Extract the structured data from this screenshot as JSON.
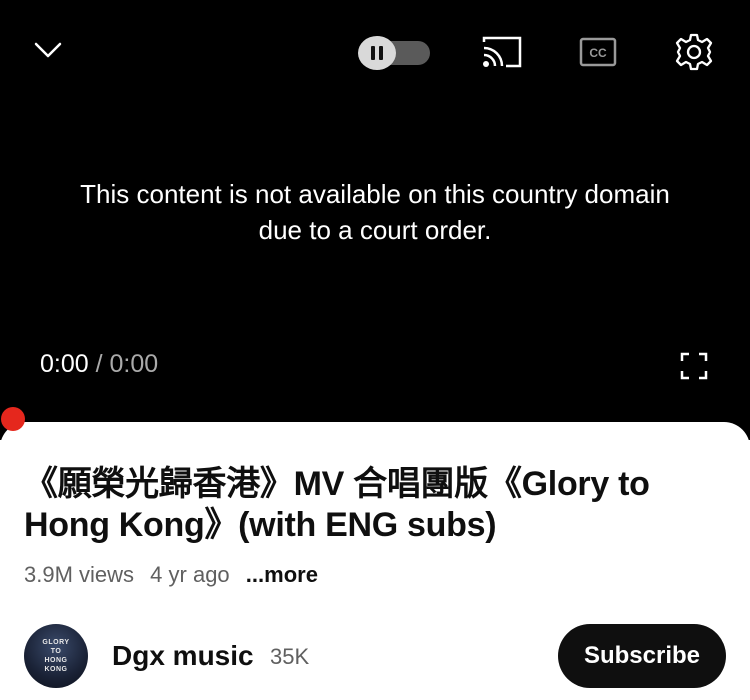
{
  "player": {
    "notice": {
      "line1": "This content is not available on this country domain",
      "line2": "due to a court order."
    },
    "time": {
      "current": "0:00",
      "separator": " / ",
      "duration": "0:00"
    },
    "icons": {
      "collapse": "chevron-down-icon",
      "autoplay": "pause-toggle-icon",
      "cast": "cast-icon",
      "captions": "closed-captions-icon",
      "settings": "gear-icon",
      "fullscreen": "fullscreen-icon"
    },
    "accent": "#e5271d"
  },
  "video": {
    "title": "《願榮光歸香港》MV 合唱團版《Glory to Hong Kong》(with ENG subs)",
    "views": "3.9M views",
    "age": "4 yr ago",
    "more": "...more"
  },
  "channel": {
    "avatar_text": [
      "GLORY",
      "TO",
      "HONG",
      "KONG"
    ],
    "name": "Dgx music",
    "subscribers": "35K",
    "subscribe_label": "Subscribe"
  }
}
